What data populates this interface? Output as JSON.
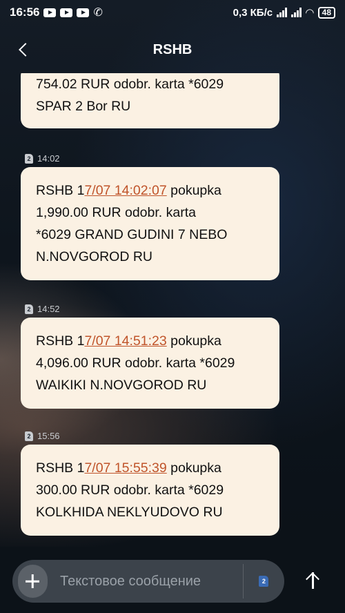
{
  "status_bar": {
    "time": "16:56",
    "network_speed": "0,3 КБ/с",
    "battery": "48"
  },
  "app_bar": {
    "title": "RSHB"
  },
  "messages": [
    {
      "lines": [
        "754.02 RUR odobr. karta *6029",
        "SPAR 2 Bor RU"
      ]
    },
    {
      "time": "14:02",
      "sim": "2",
      "prefix": "RSHB 1",
      "link": "7/07 14:02:07",
      "suffix": " pokupka",
      "lines": [
        "1,990.00 RUR odobr. karta",
        "*6029 GRAND GUDINI 7 NEBO",
        "N.NOVGOROD RU"
      ]
    },
    {
      "time": "14:52",
      "sim": "2",
      "prefix": "RSHB 1",
      "link": "7/07 14:51:23",
      "suffix": " pokupka",
      "lines": [
        "4,096.00 RUR odobr. karta *6029",
        "WAIKIKI N.NOVGOROD RU"
      ]
    },
    {
      "time": "15:56",
      "sim": "2",
      "prefix": "RSHB 1",
      "link": "7/07 15:55:39",
      "suffix": " pokupka",
      "lines": [
        "300.00 RUR odobr. karta *6029",
        "KOLKHIDA NEKLYUDOVO RU"
      ]
    }
  ],
  "composer": {
    "placeholder": "Текстовое сообщение",
    "sim": "2"
  },
  "colors": {
    "bubble": "#fbf1e3",
    "link": "#c0542a"
  }
}
